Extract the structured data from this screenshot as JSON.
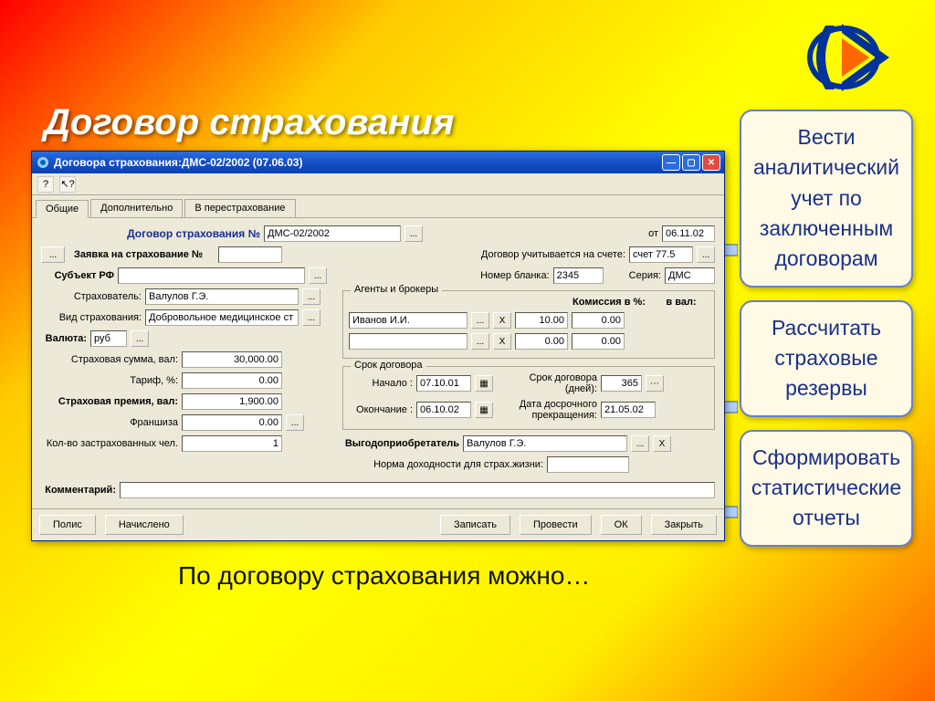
{
  "slide": {
    "title": "Договор страхования",
    "caption": "По договору страхования можно…"
  },
  "sidebar": {
    "boxes": [
      "Вести аналитический учет по заключенным договорам",
      "Рассчитать страховые резервы",
      "Сформировать статистические отчеты"
    ]
  },
  "window": {
    "title": "Договора страхования:ДМС-02/2002 (07.06.03)"
  },
  "tabs": {
    "t0": "Общие",
    "t1": "Дополнительно",
    "t2": "В перестрахование"
  },
  "form": {
    "header_label": "Договор страхования №",
    "contract_no": "ДМС-02/2002",
    "from_label": "от",
    "from_date": "06.11.02",
    "application_label": "Заявка на страхование №",
    "application_no": "",
    "account_label": "Договор учитывается на счете:",
    "account": "счет 77.5",
    "subject_label": "Субъект РФ",
    "subject": "",
    "blank_label": "Номер бланка:",
    "blank_no": "2345",
    "series_label": "Серия:",
    "series": "ДМС",
    "insurer_label": "Страхователь:",
    "insurer": "Валулов Г.Э.",
    "type_label": "Вид страхования:",
    "type": "Добровольное медицинское ст",
    "currency_label": "Валюта:",
    "currency": "руб",
    "sum_label": "Страховая сумма, вал:",
    "sum": "30,000.00",
    "tariff_label": "Тариф, %:",
    "tariff": "0.00",
    "premium_label": "Страховая премия, вал:",
    "premium": "1,900.00",
    "franchise_label": "Франшиза",
    "franchise": "0.00",
    "persons_label": "Кол-во застрахованных чел.",
    "persons": "1",
    "comment_label": "Комментарий:",
    "comment": ""
  },
  "agents": {
    "group_title": "Агенты и брокеры",
    "commission_label": "Комиссия в %:",
    "inval_label": "в вал:",
    "agent1": "Иванов И.И.",
    "agent1_pct": "10.00",
    "agent1_val": "0.00",
    "agent2": "",
    "agent2_pct": "0.00",
    "agent2_val": "0.00"
  },
  "term": {
    "group_title": "Срок договора",
    "start_label": "Начало :",
    "start": "07.10.01",
    "end_label": "Окончание :",
    "end": "06.10.02",
    "days_label": "Срок договора (дней):",
    "days": "365",
    "earlyterm_label": "Дата досрочного прекращения:",
    "earlyterm": "21.05.02"
  },
  "beneficiary": {
    "label": "Выгодоприобретатель",
    "value": "Валулов Г.Э."
  },
  "profit": {
    "label": "Норма доходности для страх.жизни:",
    "value": ""
  },
  "buttons": {
    "policy": "Полис",
    "accrued": "Начислено",
    "save": "Записать",
    "post": "Провести",
    "ok": "ОК",
    "close": "Закрыть",
    "ellipsis": "...",
    "x": "X",
    "help": "?"
  }
}
